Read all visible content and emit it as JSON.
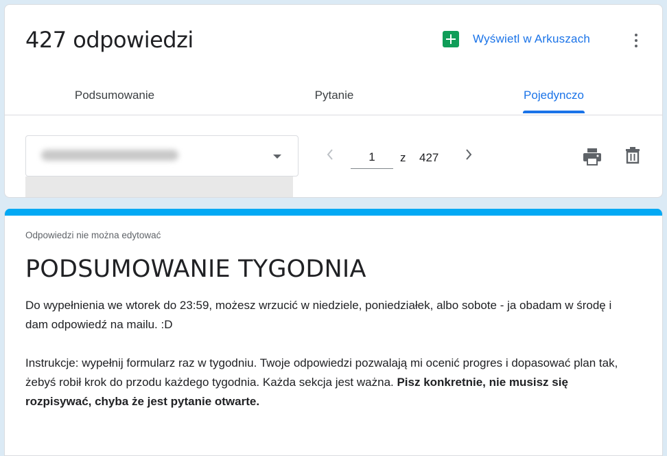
{
  "header": {
    "response_count": "427 odpowiedzi",
    "sheets_link": "Wyświetl w Arkuszach",
    "sheets_icon": "google-sheets-icon",
    "more_icon": "more-vert-icon"
  },
  "tabs": [
    {
      "label": "Podsumowanie",
      "active": false
    },
    {
      "label": "Pytanie",
      "active": false
    },
    {
      "label": "Pojedynczo",
      "active": true
    }
  ],
  "individual": {
    "email_value": "",
    "current_page": "1",
    "of_label": "z",
    "total_pages": "427"
  },
  "form": {
    "readonly_note": "Odpowiedzi nie można edytować",
    "title": "PODSUMOWANIE TYGODNIA",
    "desc_p1": "Do wypełnienia we wtorek do 23:59, możesz wrzucić w niedziele, poniedziałek, albo sobote - ja obadam w środę i dam odpowiedź na mailu. :D",
    "desc_p2_normal": "Instrukcje: wypełnij formularz raz w tygodniu. Twoje odpowiedzi pozwalają mi ocenić progres i dopasować plan tak, żebyś robił krok do przodu każdego tygodnia. Każda sekcja jest ważna. ",
    "desc_p2_bold": "Pisz konkretnie, nie musisz się rozpisywać, chyba że jest pytanie otwarte."
  },
  "colors": {
    "accent_blue": "#1a73e8",
    "form_accent": "#03a9f4",
    "sheets_green": "#0f9d58"
  }
}
